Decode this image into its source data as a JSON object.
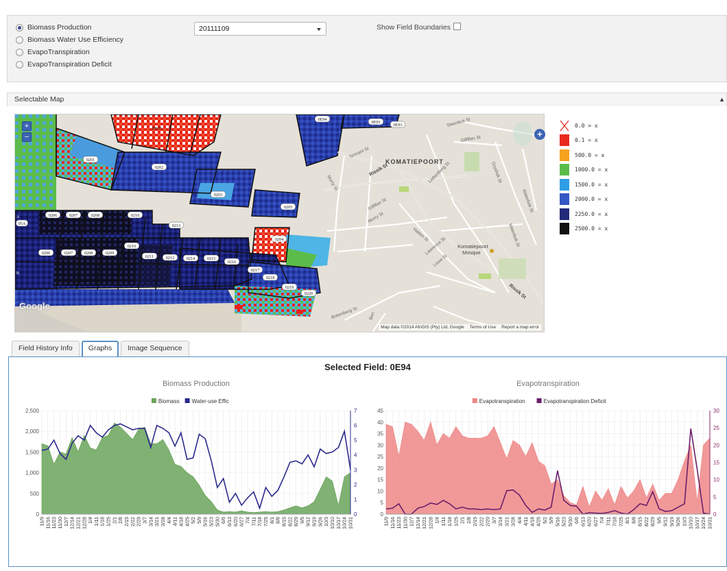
{
  "controls": {
    "layers": [
      {
        "label": "Biomass Production",
        "checked": true
      },
      {
        "label": "Biomass Water Use Efficiency",
        "checked": false
      },
      {
        "label": "EvapoTranspiration",
        "checked": false
      },
      {
        "label": "EvapoTranspiration Deficit",
        "checked": false
      }
    ],
    "date_value": "20111109",
    "show_boundaries_label": "Show Field Boundaries",
    "show_boundaries_checked": false
  },
  "map_section": {
    "header": "Selectable Map",
    "collapse_icon": "triangle-up-icon",
    "zoom_in": "+",
    "zoom_out": "−",
    "google": "Google",
    "attribution": {
      "data": "Map data ©2014 AfriGIS (Pty) Ltd, Google",
      "terms": "Terms of Use",
      "report": "Report a map error"
    },
    "town_label": "KOMATIEPOORT",
    "mosque_label": [
      "Komatiepoort",
      "Mosque"
    ],
    "streets": [
      "Steenbok St",
      "Giffillan St",
      "Tennant St",
      "Rissik St",
      "Murry St",
      "Liebenberg St",
      "Giffillan St",
      "Murry St",
      "Hatton St",
      "Lawrence St",
      "Louw St",
      "Gryshok St",
      "Waterbok St",
      "Waterbok St",
      "Rissik St",
      "Bokenberg St",
      "Ben"
    ],
    "field_labels": [
      "EB25",
      "0E94",
      "0E93",
      "0E93",
      "0201",
      "0202",
      "0203",
      "0205",
      "0206",
      "0207",
      "0208",
      "0210",
      "0213",
      "05A",
      "0204",
      "0206",
      "0207",
      "0208",
      "0209",
      "0210",
      "0211",
      "0212",
      "0214",
      "0215",
      "0216",
      "0217",
      "0218",
      "0219",
      "0220",
      "A",
      "B"
    ]
  },
  "legend": {
    "items": [
      {
        "label": "0.0 > x",
        "color": "#ffffff",
        "icon": "x-mark-icon"
      },
      {
        "label": "0.1 = x",
        "color": "#e8291c"
      },
      {
        "label": "500.0 = x",
        "color": "#f6a21d"
      },
      {
        "label": "1000.0 = x",
        "color": "#5cbc4a"
      },
      {
        "label": "1500.0 = x",
        "color": "#2f9ee3"
      },
      {
        "label": "2000.0 = x",
        "color": "#3358c4"
      },
      {
        "label": "2250.0 = x",
        "color": "#222a7a"
      },
      {
        "label": "2500.0 = x",
        "color": "#111111"
      }
    ]
  },
  "tabs": [
    {
      "label": "Field History Info",
      "active": false
    },
    {
      "label": "Graphs",
      "active": true
    },
    {
      "label": "Image Sequence",
      "active": false
    }
  ],
  "graphs": {
    "selected_field": "Selected Field: 0E94"
  },
  "chart_data": [
    {
      "type": "area",
      "title": "Biomass Production",
      "categories": [
        "11/9",
        "11/16",
        "11/23",
        "11/30",
        "12/7",
        "12/14",
        "12/21",
        "12/28",
        "1/4",
        "1/11",
        "1/18",
        "1/25",
        "2/1",
        "2/8",
        "2/15",
        "2/22",
        "2/29",
        "3/7",
        "3/14",
        "3/21",
        "3/28",
        "4/4",
        "4/11",
        "4/18",
        "4/25",
        "5/2",
        "5/9",
        "5/16",
        "5/23",
        "5/30",
        "6/6",
        "6/13",
        "6/20",
        "6/27",
        "7/4",
        "7/11",
        "7/18",
        "7/25",
        "8/1",
        "8/8",
        "8/15",
        "8/22",
        "8/29",
        "9/5",
        "9/12",
        "9/19",
        "9/26",
        "10/3",
        "10/10",
        "10/17",
        "10/24",
        "10/31"
      ],
      "series": [
        {
          "name": "Biomass",
          "type": "area",
          "axis": "left",
          "color": "#6aa55a",
          "values": [
            1700,
            1650,
            1200,
            1500,
            1450,
            1850,
            1500,
            1900,
            1600,
            1550,
            1850,
            1900,
            2200,
            2100,
            1950,
            1800,
            2050,
            2100,
            1700,
            1700,
            1800,
            1550,
            1200,
            1150,
            1000,
            900,
            700,
            450,
            300,
            100,
            50,
            60,
            50,
            80,
            50,
            40,
            50,
            60,
            50,
            60,
            100,
            150,
            200,
            150,
            200,
            300,
            600,
            900,
            800,
            200,
            900,
            1000
          ]
        },
        {
          "name": "Water-use Effic",
          "type": "line",
          "axis": "right",
          "color": "#2a2a8c",
          "values": [
            4.3,
            4.4,
            5.0,
            4.1,
            3.7,
            4.8,
            5.3,
            5.0,
            6.0,
            5.5,
            5.2,
            5.7,
            6.0,
            6.1,
            5.9,
            5.7,
            5.8,
            5.8,
            4.5,
            6.0,
            5.8,
            5.5,
            4.6,
            5.5,
            3.7,
            3.8,
            5.4,
            5.1,
            3.6,
            1.8,
            2.4,
            0.8,
            1.4,
            0.6,
            1.1,
            1.5,
            0.4,
            1.8,
            1.2,
            1.6,
            2.5,
            3.5,
            3.6,
            3.4,
            4.0,
            3.2,
            4.4,
            4.1,
            4.2,
            4.5,
            5.6,
            3.0
          ]
        }
      ],
      "ylim_left": [
        0,
        2500
      ],
      "yticks_left": [
        "0",
        "500",
        "1,000",
        "1,500",
        "2,000",
        "2,500"
      ],
      "ylim_right": [
        0,
        7
      ],
      "yticks_right": [
        "0",
        "1",
        "2",
        "3",
        "4",
        "5",
        "6",
        "7"
      ],
      "legend_position": "top-center"
    },
    {
      "type": "area",
      "title": "Evapotranspiration",
      "categories": [
        "11/9",
        "11/16",
        "11/23",
        "11/30",
        "12/7",
        "12/14",
        "12/21",
        "12/28",
        "1/4",
        "1/11",
        "1/18",
        "1/25",
        "2/1",
        "2/8",
        "2/15",
        "2/22",
        "2/29",
        "3/7",
        "3/14",
        "3/21",
        "3/28",
        "4/4",
        "4/11",
        "4/18",
        "4/25",
        "5/2",
        "5/9",
        "5/16",
        "5/23",
        "5/30",
        "6/6",
        "6/13",
        "6/20",
        "6/27",
        "7/4",
        "7/11",
        "7/18",
        "7/25",
        "8/1",
        "8/8",
        "8/15",
        "8/22",
        "8/29",
        "9/5",
        "9/12",
        "9/19",
        "9/26",
        "10/3",
        "10/10",
        "10/17",
        "10/24",
        "10/31"
      ],
      "series": [
        {
          "name": "Evapotranspiration",
          "type": "area",
          "axis": "left",
          "color": "#ef8787",
          "values": [
            39,
            38,
            25,
            40,
            39,
            36,
            32,
            40,
            30,
            35,
            33,
            38,
            34,
            33,
            33,
            33,
            34,
            38,
            31,
            24,
            32,
            30,
            25,
            31,
            23,
            21,
            13,
            15,
            8,
            5,
            4,
            12,
            3,
            10,
            6,
            11,
            4,
            12,
            7,
            10,
            15,
            7,
            13,
            6,
            9,
            9,
            15,
            23,
            30,
            5,
            30,
            33
          ]
        },
        {
          "name": "Evapotranspiration Deficit",
          "type": "line",
          "axis": "right",
          "color": "#6a1f6a",
          "values": [
            1.5,
            1.7,
            3.0,
            0,
            0,
            1.7,
            2.2,
            3.2,
            2.8,
            4.0,
            3.0,
            1.5,
            2.0,
            1.5,
            1.5,
            1.3,
            1.5,
            1.3,
            1.5,
            6.8,
            7.0,
            5.5,
            2.5,
            0.5,
            1.5,
            1.2,
            2.0,
            12.6,
            4.0,
            2.5,
            2.3,
            0,
            0.4,
            0.3,
            0.2,
            0.5,
            1.0,
            0.3,
            0,
            1.3,
            3.0,
            2.5,
            6.5,
            1.5,
            0.8,
            1.0,
            2.0,
            3.0,
            24.8,
            13.0,
            0.3,
            0
          ]
        }
      ],
      "ylim_left": [
        0,
        45
      ],
      "yticks_left": [
        "0",
        "5",
        "10",
        "15",
        "20",
        "25",
        "30",
        "35",
        "40",
        "45"
      ],
      "ylim_right": [
        0,
        30
      ],
      "yticks_right": [
        "0",
        "5",
        "10",
        "15",
        "20",
        "25",
        "30"
      ],
      "legend_position": "top-center"
    }
  ]
}
